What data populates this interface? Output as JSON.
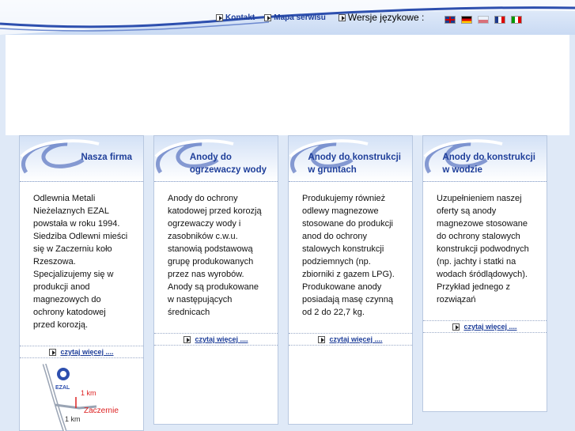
{
  "topnav": {
    "kontakt": "Kontakt",
    "mapa": "Mapa serwisu",
    "wersje": "Wersje językowe :"
  },
  "languages": [
    {
      "code": "en",
      "icon": "flag-uk-icon"
    },
    {
      "code": "de",
      "icon": "flag-germany-icon"
    },
    {
      "code": "pl",
      "icon": "flag-poland-icon"
    },
    {
      "code": "fr",
      "icon": "flag-france-icon"
    },
    {
      "code": "it",
      "icon": "flag-italy-icon"
    }
  ],
  "cards": [
    {
      "title_l1": "Nasza firma",
      "title_l2": "",
      "lines": [
        "Odlewnia Metali",
        "Nieżelaznych EZAL",
        "powstała w roku 1994.",
        "Siedziba Odlewni mieści",
        "się w Zaczerniu koło",
        "Rzeszowa.",
        "Specjalizujemy się w",
        "produkcji anod",
        "magnezowych do",
        "ochrony katodowej",
        "przed korozją."
      ],
      "more": "czytaj więcej ...."
    },
    {
      "title_l1": "Anody do",
      "title_l2": "ogrzewaczy wody",
      "lines": [
        "Anody do ochrony",
        "katodowej przed korozją",
        "ogrzewaczy wody i",
        "zasobników c.w.u.",
        "stanowią podstawową",
        "grupę produkowanych",
        "przez nas wyrobów.",
        "Anody są produkowane",
        "w następujących",
        "średnicach"
      ],
      "more": "czytaj więcej ...."
    },
    {
      "title_l1": "Anody do konstrukcji",
      "title_l2": "w gruntach",
      "lines": [
        "Produkujemy również",
        "odlewy magnezowe",
        "stosowane do produkcji",
        "anod do ochrony",
        "stalowych konstrukcji",
        "podziemnych (np.",
        "zbiorniki z gazem LPG).",
        "Produkowane anody",
        "posiadają masę czynną",
        "od 2 do 22,7 kg."
      ],
      "more": "czytaj więcej ...."
    },
    {
      "title_l1": "Anody do konstrukcji",
      "title_l2": "w wodzie",
      "lines": [
        "Uzupełnieniem naszej",
        "oferty są anody",
        "magnezowe stosowane",
        "do ochrony stalowych",
        "konstrukcji podwodnych",
        "(np. jachty i statki na",
        "wodach śródlądowych).",
        "Przykład jednego z",
        "rozwiązań"
      ],
      "more": "czytaj więcej ...."
    }
  ],
  "map": {
    "logo": "EZAL",
    "dist1": "1 km",
    "dist2": "1 km",
    "place": "Zaczernie"
  }
}
